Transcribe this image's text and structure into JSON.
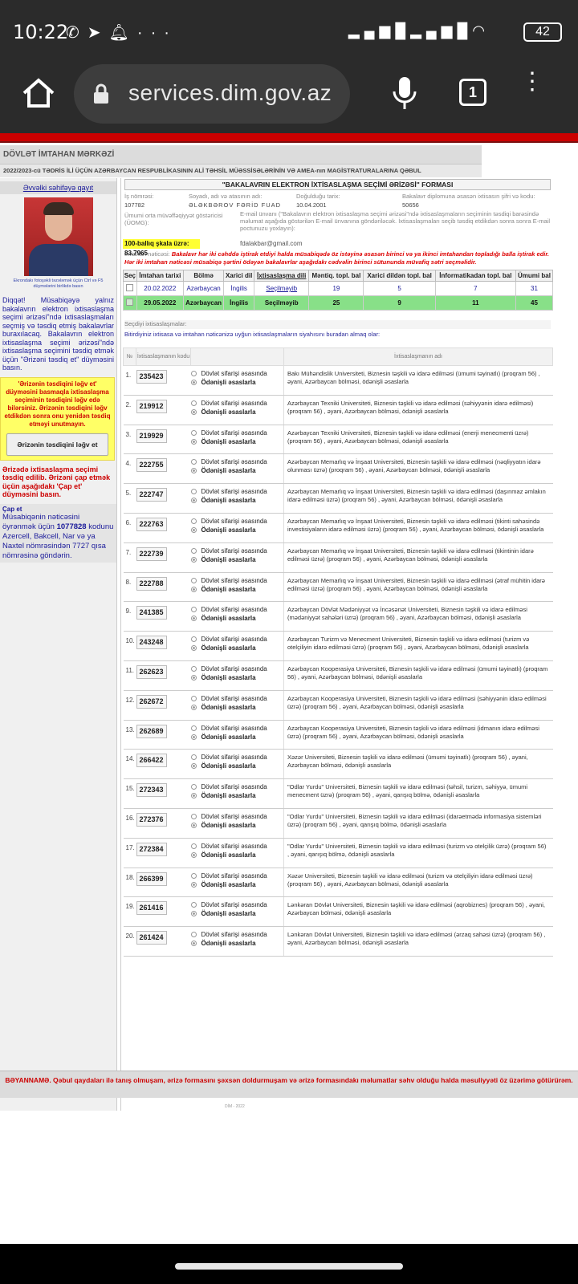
{
  "status_bar": {
    "time": "10:22",
    "battery": "42",
    "left_icons": [
      "whatsapp-icon",
      "telegram-icon",
      "bell-icon",
      "more-dots-icon"
    ],
    "right_icons": [
      "signal-icon",
      "signal-icon",
      "wifi-icon"
    ]
  },
  "browser": {
    "url": "services.dim.gov.az",
    "tab_count": "1"
  },
  "site": {
    "org_name": "DÖVLƏT İMTAHAN MƏRKƏZİ",
    "subtitle": "2022/2023-cü TƏDRİS İLİ ÜÇÜN AZƏRBAYCAN RESPUBLİKASININ ALİ TƏHSİL MÜƏSSİSƏLƏRİNİN VƏ AMEA-nın MAGİSTRATURALARINA QƏBUL"
  },
  "sidebar": {
    "back_link": "Əvvəlki səhifəyə qayıt",
    "photo_caption": "Ekrondakı fotoşəkli təzələmək üçün Ctrl və F5 düymələrini birlikdə basın",
    "note1": "Diqqət! Müsabiqəyə yalnız bakalavrın elektron ixtisaslaşma seçimi ərizəsi\"ndə ixtisaslaşmaları seçmiş və təsdiq etmiş bakalavrlar buraxılacaq. Bakalavrın elektron ixtisaslaşma seçimi ərizəsi\"ndə ixtisaslaşma seçimini təsdiq etmək üçün \"Ərizəni təsdiq et\" düyməsini basın.",
    "warning": "'Ərizənin təsdiqini ləğv et' düyməsini basmaqla ixtisaslaşma seçiminin təsdiqini ləğv edə bilərsiniz. Ərizənin təsdiqini ləğv etdikdən sonra onu yenidən təsdiq etməyi unutmayın.",
    "cancel_button": "Ərizənin təsdiqini ləğv et",
    "note2": "Ərizədə ixtisaslaşma seçimi təsdiq edilib. Ərizəni çap etmək üçün aşağıdakı 'Çap et' düyməsini basın.",
    "print_link": "Çap et",
    "sms_prefix": "Müsabiqənin nəticəsini öyrənmək üçün",
    "sms_code": "1077828",
    "sms_suffix": "kodunu Azercell, Bakcell, Nar və ya Naxtel nömrəsindən 7727 qısa nömrəsinə göndərin."
  },
  "form": {
    "title": "\"BAKALAVRIN ELEKTRON İXTİSASLAŞMA SEÇİMİ ƏRİZƏSİ\" FORMASI",
    "labels": {
      "id": "İş nömrəsi:",
      "name": "Soyadı, adı və atasının adı:",
      "dob": "Doğulduğu tarix:",
      "diploma": "Bakalavr diplomuna əsasən ixtisasın şifri və kodu:",
      "gpa": "Ümumi orta müvəffəqiyyət göstəricisi (ÜOMG):",
      "email": "E-mail ünvanı (\"Bakalavrın elektron ixtisaslaşma seçimi ərizəsi\"ndə ixtisaslaşmaların seçiminin təsdiqi barəsində məlumat aşağıda göstərilən E-mail ünvanına göndəriləcək. İxtisaslaşmaları seçib təsdiq etdikdən sonra sonra E-mail poctunuzu yoxlayın):",
      "result": "İmtahan nəticəsi:"
    },
    "values": {
      "id": "107782",
      "name": "ƏLƏKBƏROV FƏRİD FUAD",
      "dob": "10.04.2001",
      "diploma": "50656",
      "gpa_scale": "100-ballıq şkala üzrə: 83.7965",
      "email": "fdalakbar@gmail.com"
    },
    "result_note": "Bakalavr hər iki cəhddə iştirak etdiyi halda müsabiqədə öz istəyinə əsasən birinci və ya ikinci imtahandan topladığı balla iştirak edir. Hər iki imtahan nəticəsi müsabiqə şərtini ödəyən bakalavrlar aşağıdakı cədvəlin birinci sütununda müvafiq sətri seçməlidir."
  },
  "exams": {
    "headers": [
      "Seç",
      "İmtahan tarixi",
      "Bölmə",
      "Xarici dil",
      "İxtisaslaşma dili",
      "Məntiq. topl. bal",
      "Xarici dildən topl. bal",
      "İnformatikadan topl. bal",
      "Ümumi bal"
    ],
    "rows": [
      {
        "date": "20.02.2022",
        "section": "Azərbaycan",
        "lang": "İngilis",
        "spec_lang": "Seçilməyib",
        "logic": "19",
        "foreign": "5",
        "it": "7",
        "total": "31",
        "selected": false
      },
      {
        "date": "29.05.2022",
        "section": "Azərbaycan",
        "lang": "İngilis",
        "spec_lang": "Seçilməyib",
        "logic": "25",
        "foreign": "9",
        "it": "11",
        "total": "45",
        "selected": true
      }
    ]
  },
  "specs": {
    "section_label": "Seçdiyi ixtisaslaşmalar:",
    "note": "Bitirdiyiniz ixtisasa və imtahan nəticənizə uyğun ixtisaslaşmaların siyahısını buradan almaq olar:",
    "headers": {
      "num": "№",
      "code": "İxtisaslaşmanın kodu",
      "name": "İxtisaslaşmanın adı"
    },
    "option1": "Dövlət sifarişi əsasında",
    "option2": "Ödənişli əsaslarla",
    "rows": [
      {
        "n": "1.",
        "code": "235423",
        "name": "Bakı Mühəndislik Universiteti, Biznesin təşkili və idarə edilməsi (ümumi təyinatlı) (proqram 56) , əyani, Azərbaycan bölməsi, ödənişli əsaslarla"
      },
      {
        "n": "2.",
        "code": "219912",
        "name": "Azərbaycan Texniki Universiteti, Biznesin təşkili və idarə edilməsi (səhiyyənin idarə edilməsi) (proqram 56) , əyani, Azərbaycan bölməsi, ödənişli əsaslarla"
      },
      {
        "n": "3.",
        "code": "219929",
        "name": "Azərbaycan Texniki Universiteti, Biznesin təşkili və idarə edilməsi (enerji menecmenti üzrə) (proqram 56) , əyani, Azərbaycan bölməsi, ödənişli əsaslarla"
      },
      {
        "n": "4.",
        "code": "222755",
        "name": "Azərbaycan Memarlıq və İnşaat Universiteti, Biznesin təşkili və idarə edilməsi (nəqliyyatın idarə olunması üzrə) (proqram 56) , əyani, Azərbaycan bölməsi, ödənişli əsaslarla"
      },
      {
        "n": "5.",
        "code": "222747",
        "name": "Azərbaycan Memarlıq və İnşaat Universiteti, Biznesin təşkili və idarə edilməsi (daşınmaz əmlakın idarə edilməsi üzrə) (proqram 56) , əyani, Azərbaycan bölməsi, ödənişli əsaslarla"
      },
      {
        "n": "6.",
        "code": "222763",
        "name": "Azərbaycan Memarlıq və İnşaat Universiteti, Biznesin təşkili və idarə edilməsi (tikinti sahəsində investisiyaların idarə edilməsi üzrə) (proqram 56) , əyani, Azərbaycan bölməsi, ödənişli əsaslarla"
      },
      {
        "n": "7.",
        "code": "222739",
        "name": "Azərbaycan Memarlıq və İnşaat Universiteti, Biznesin təşkili və idarə edilməsi (tikintinin idarə edilməsi üzrə) (proqram 56) , əyani, Azərbaycan bölməsi, ödənişli əsaslarla"
      },
      {
        "n": "8.",
        "code": "222788",
        "name": "Azərbaycan Memarlıq və İnşaat Universiteti, Biznesin təşkili və idarə edilməsi (ətraf mühitin idarə edilməsi üzrə) (proqram 56) , əyani, Azərbaycan bölməsi, ödənişli əsaslarla"
      },
      {
        "n": "9.",
        "code": "241385",
        "name": "Azərbaycan Dövlət Mədəniyyət və İncəsənət Universiteti, Biznesin təşkili və idarə edilməsi (mədəniyyət sahələri üzrə) (proqram 56) , əyani, Azərbaycan bölməsi, ödənişli əsaslarla"
      },
      {
        "n": "10.",
        "code": "243248",
        "name": "Azərbaycan Turizm və Menecment Universiteti, Biznesin təşkili və idarə edilməsi (turizm və otelçiliyin idarə edilməsi üzrə) (proqram 56) , əyani, Azərbaycan bölməsi, ödənişli əsaslarla"
      },
      {
        "n": "11.",
        "code": "262623",
        "name": "Azərbaycan Kooperasiya Universiteti, Biznesin təşkili və idarə edilməsi (ümumi təyinatlı) (proqram 56) , əyani, Azərbaycan bölməsi, ödənişli əsaslarla"
      },
      {
        "n": "12.",
        "code": "262672",
        "name": "Azərbaycan Kooperasiya Universiteti, Biznesin təşkili və idarə edilməsi (səhiyyənin idarə edilməsi üzrə) (proqram 56) , əyani, Azərbaycan bölməsi, ödənişli əsaslarla"
      },
      {
        "n": "13.",
        "code": "262689",
        "name": "Azərbaycan Kooperasiya Universiteti, Biznesin təşkili və idarə edilməsi (idmanın idarə edilməsi üzrə) (proqram 56) , əyani, Azərbaycan bölməsi, ödənişli əsaslarla"
      },
      {
        "n": "14.",
        "code": "266422",
        "name": "Xəzər Universiteti, Biznesin təşkili və idarə edilməsi (ümumi təyinatlı) (proqram 56) , əyani, Azərbaycan bölməsi, ödənişli əsaslarla"
      },
      {
        "n": "15.",
        "code": "272343",
        "name": "\"Odlar Yurdu\" Universiteti, Biznesin təşkili və idarə edilməsi (təhsil, turizm, səhiyyə, ümumi menecment üzrə) (proqram 56) , əyani, qarışıq bölmə, ödənişli əsaslarla"
      },
      {
        "n": "16.",
        "code": "272376",
        "name": "\"Odlar Yurdu\" Universiteti, Biznesin təşkili və idarə edilməsi (idarəetmədə informasiya sistemləri üzrə) (proqram 56) , əyani, qarışıq bölmə, ödənişli əsaslarla"
      },
      {
        "n": "17.",
        "code": "272384",
        "name": "\"Odlar Yurdu\" Universiteti, Biznesin təşkili və idarə edilməsi (turizm və otelçilik üzrə) (proqram 56) , əyani, qarışıq bölmə, ödənişli əsaslarla"
      },
      {
        "n": "18.",
        "code": "266399",
        "name": "Xəzər Universiteti, Biznesin təşkili və idarə edilməsi (turizm və otelçiliyin idarə edilməsi üzrə) (proqram 56) , əyani, Azərbaycan bölməsi, ödənişli əsaslarla"
      },
      {
        "n": "19.",
        "code": "261416",
        "name": "Lənkəran Dövlət Universiteti, Biznesin təşkili və idarə edilməsi (aqrobiznes) (proqram 56) , əyani, Azərbaycan bölməsi, ödənişli əsaslarla"
      },
      {
        "n": "20.",
        "code": "261424",
        "name": "Lənkəran Dövlət Universiteti, Biznesin təşkili və idarə edilməsi (ərzaq sahəsi üzrə) (proqram 56) , əyani, Azərbaycan bölməsi, ödənişli əsaslarla"
      }
    ]
  },
  "declaration": "BƏYANNAMƏ. Qəbul qaydaları ilə tanış olmuşam, ərizə formasını şəxsən doldurmuşam və ərizə formasındakı məlumatlar səhv olduğu halda məsuliyyəti öz üzərimə götürürəm.",
  "copyright": "DİM - 2022"
}
